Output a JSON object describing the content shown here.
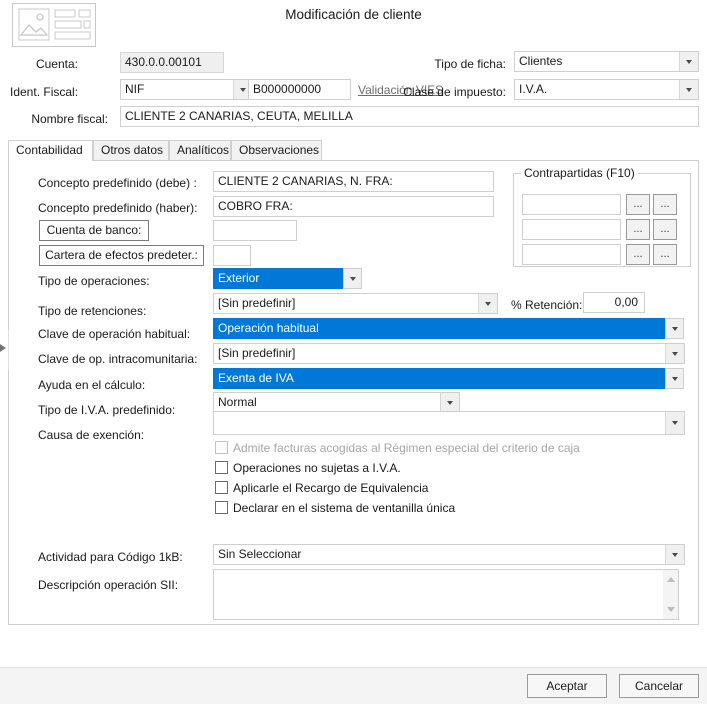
{
  "window": {
    "title": "Modificación de cliente",
    "app_icon": "image-placeholder-icon"
  },
  "header": {
    "cuenta_label": "Cuenta:",
    "cuenta_value": "430.0.0.00101",
    "ident_fiscal_label": "Ident. Fiscal:",
    "ident_fiscal_type": "NIF",
    "ident_fiscal_number": "B000000000",
    "vies_link": "Validación VIES",
    "nombre_fiscal_label": "Nombre fiscal:",
    "nombre_fiscal_value": "CLIENTE 2 CANARIAS, CEUTA, MELILLA",
    "tipo_ficha_label": "Tipo de ficha:",
    "tipo_ficha_value": "Clientes",
    "clase_impuesto_label": "Clase de impuesto:",
    "clase_impuesto_value": "I.V.A."
  },
  "tabs": [
    {
      "label": "Contabilidad",
      "active": true
    },
    {
      "label": "Otros datos",
      "active": false
    },
    {
      "label": "Analíticos",
      "active": false
    },
    {
      "label": "Observaciones",
      "active": false
    }
  ],
  "contabilidad": {
    "concepto_debe_label": "Concepto predefinido (debe) :",
    "concepto_debe_value": "CLIENTE 2 CANARIAS,  N. FRA:",
    "concepto_haber_label": "Concepto predefinido (haber):",
    "concepto_haber_value": "COBRO FRA:",
    "cuenta_banco_button": "Cuenta de banco:",
    "cuenta_banco_value": "",
    "cartera_efectos_button": "Cartera de efectos predeter.:",
    "cartera_efectos_value": "",
    "tipo_operaciones_label": "Tipo de operaciones:",
    "tipo_operaciones_value": "Exterior",
    "tipo_retenciones_label": "Tipo de retenciones:",
    "tipo_retenciones_value": "[Sin predefinir]",
    "pct_retencion_label": "% Retención:",
    "pct_retencion_value": "0,00",
    "clave_operacion_habitual_label": "Clave de operación habitual:",
    "clave_operacion_habitual_value": "Operación habitual",
    "clave_intracomunitaria_label": "Clave de op. intracomunitaria:",
    "clave_intracomunitaria_value": "[Sin predefinir]",
    "ayuda_calculo_label": "Ayuda en el cálculo:",
    "ayuda_calculo_value": "Exenta de IVA",
    "tipo_iva_label": "Tipo de I.V.A. predefinido:",
    "tipo_iva_value": "Normal",
    "causa_exencion_label": "Causa de exención:",
    "causa_exencion_value": "",
    "actividad_label": "Actividad para Código 1kB:",
    "actividad_value": "Sin Seleccionar",
    "descripcion_sii_label": "Descripción operación SII:",
    "descripcion_sii_value": ""
  },
  "contrapartidas": {
    "legend": "Contrapartidas (F10)",
    "rows": [
      {
        "value": "",
        "btn1": "...",
        "btn2": "..."
      },
      {
        "value": "",
        "btn1": "...",
        "btn2": "..."
      },
      {
        "value": "",
        "btn1": "...",
        "btn2": "..."
      }
    ]
  },
  "checkboxes": [
    {
      "label": "Admite facturas acogidas al Régimen especial del criterio de caja",
      "checked": false,
      "disabled": true
    },
    {
      "label": "Operaciones no sujetas a I.V.A.",
      "checked": false,
      "disabled": false
    },
    {
      "label": "Aplicarle el Recargo de Equivalencia",
      "checked": false,
      "disabled": false
    },
    {
      "label": "Declarar en el sistema de ventanilla única",
      "checked": false,
      "disabled": false
    }
  ],
  "footer": {
    "accept_label": "Aceptar",
    "cancel_label": "Cancelar"
  },
  "colors": {
    "accent_blue": "#0078d7",
    "border_grey": "#cfcfcf",
    "footer_bg": "#f4f4f4"
  }
}
